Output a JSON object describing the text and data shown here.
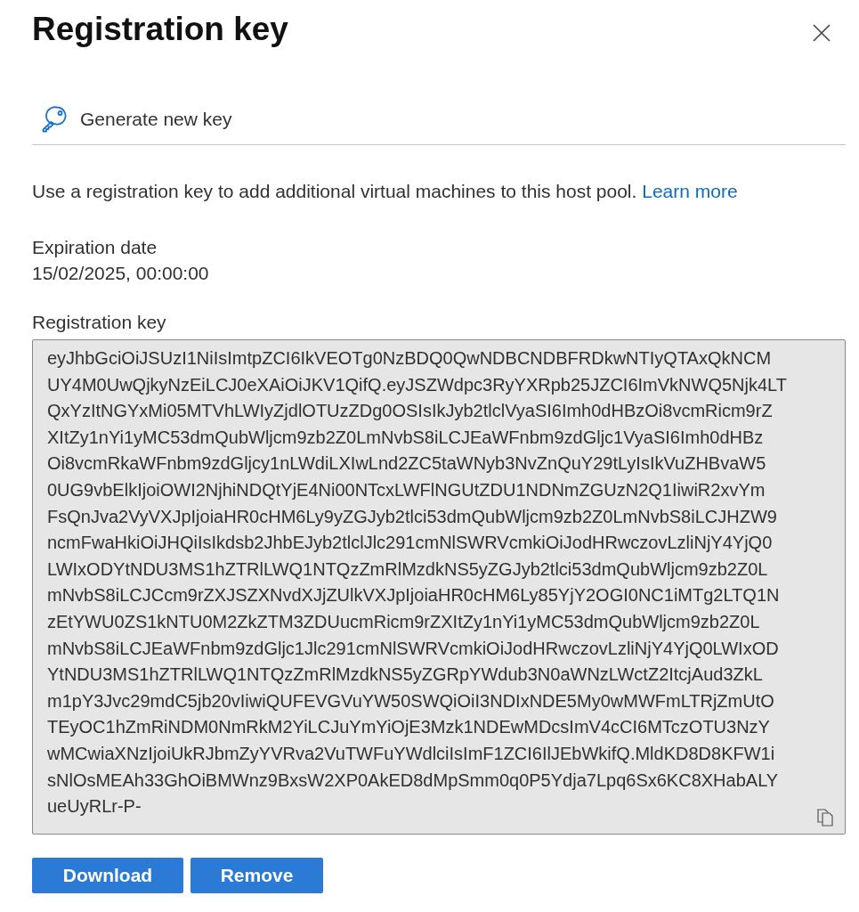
{
  "panel": {
    "title": "Registration key"
  },
  "toolbar": [
    {
      "label": "Generate new key"
    }
  ],
  "description": {
    "text": "Use a registration key to add additional virtual machines to this host pool.",
    "link": "Learn more"
  },
  "fields": [
    {
      "label": "Expiration date",
      "value": "15/02/2025, 00:00:00"
    }
  ],
  "registration_key": {
    "label": "Registration key",
    "lines": [
      "eyJhbGciOiJSUzI1NiIsImtpZCI6IkVEOTg0NzBDQ0QwNDBCNDBFRDkwNTIyQTAxQkNCM",
      "UY4M0UwQjkyNzEiLCJ0eXAiOiJKV1QifQ.eyJSZWdpc3RyYXRpb25JZCI6ImVkNWQ5Njk4LT",
      "QxYzItNGYxMi05MTVhLWIyZjdlOTUzZDg0OSIsIkJyb2tlclVyaSI6Imh0dHBzOi8vcmRicm9rZ",
      "XItZy1nYi1yMC53dmQubWljcm9zb2Z0LmNvbS8iLCJEaWFnbm9zdGljc1VyaSI6Imh0dHBz",
      "Oi8vcmRkaWFnbm9zdGljcy1nLWdiLXIwLnd2ZC5taWNyb3NvZnQuY29tLyIsIkVuZHBvaW5",
      "0UG9vbElkIjoiOWI2NjhiNDQtYjE4Ni00NTcxLWFlNGUtZDU1NDNmZGUzN2Q1IiwiR2xvYm",
      "FsQnJva2VyVXJpIjoiaHR0cHM6Ly9yZGJyb2tlci53dmQubWljcm9zb2Z0LmNvbS8iLCJHZW9",
      "ncmFwaHkiOiJHQiIsIkdsb2JhbEJyb2tlclJlc291cmNlSWRVcmkiOiJodHRwczovLzliNjY4YjQ0",
      "LWIxODYtNDU3MS1hZTRlLWQ1NTQzZmRlMzdkNS5yZGJyb2tlci53dmQubWljcm9zb2Z0L",
      "mNvbS8iLCJCcm9rZXJSZXNvdXJjZUlkVXJpIjoiaHR0cHM6Ly85YjY2OGI0NC1iMTg2LTQ1N",
      "zEtYWU0ZS1kNTU0M2ZkZTM3ZDUucmRicm9rZXItZy1nYi1yMC53dmQubWljcm9zb2Z0L",
      "mNvbS8iLCJEaWFnbm9zdGljc1Jlc291cmNlSWRVcmkiOiJodHRwczovLzliNjY4YjQ0LWIxOD",
      "YtNDU3MS1hZTRlLWQ1NTQzZmRlMzdkNS5yZGRpYWdub3N0aWNzLWctZ2ItcjAud3ZkL",
      "m1pY3Jvc29mdC5jb20vIiwiQUFEVGVuYW50SWQiOiI3NDIxNDE5My0wMWFmLTRjZmUtO",
      "TEyOC1hZmRiNDM0NmRkM2YiLCJuYmYiOjE3Mzk1NDEwMDcsImV4cCI6MTczOTU3NzY",
      "wMCwiaXNzIjoiUkRJbmZyYVRva2VuTWFuYWdlciIsImF1ZCI6IlJEbWkifQ.MldKD8D8KFW1i",
      "sNlOsMEAh33GhOiBMWnz9BxsW2XP0AkED8dMpSmm0q0P5Ydja7Lpq6Sx6KC8XHabALY",
      "ueUyRLr-P-"
    ]
  },
  "buttons": [
    {
      "label": "Download"
    },
    {
      "label": "Remove"
    }
  ]
}
